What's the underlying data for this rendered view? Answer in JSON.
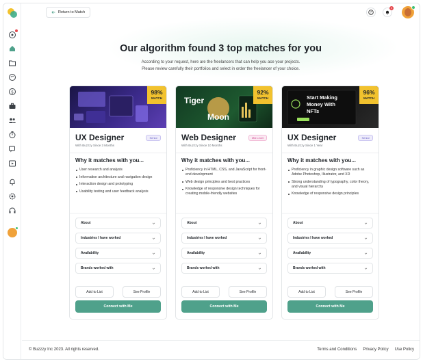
{
  "topbar": {
    "back_label": "Return to Match",
    "notification_count": "3"
  },
  "header": {
    "title": "Our algorithm found 3 top matches for you",
    "subtitle_line1": "According to your request, here are the freelancers that can help you ace your projects.",
    "subtitle_line2": "Please review carefully their portfolios and select in order the freelancer of your choice."
  },
  "cards": [
    {
      "match_pct": "98%",
      "match_label": "MATCH",
      "role": "UX Designer",
      "level": "Senior",
      "since": "With Buzzzy Since 3 Months",
      "why_title": "Why it matches with you...",
      "bullets": [
        "User research and analysis",
        "Information architecture and navigation design",
        "Interaction design and prototyping",
        "Usability testing and user feedback analysis"
      ],
      "accordions": [
        "About",
        "Industries I have worked",
        "Availability",
        "Brands worked with"
      ],
      "add_label": "Add to List",
      "profile_label": "See Profile",
      "connect_label": "Connect with Me",
      "level_color": "#6a63c7",
      "level_bg": "#eeecfb"
    },
    {
      "match_pct": "92%",
      "match_label": "MATCH",
      "role": "Web Designer",
      "level": "Mid Level",
      "since": "With Buzzzy Since 10 Months",
      "why_title": "Why it matches with you...",
      "hero_text_1": "Tiger",
      "hero_text_2": "Moon",
      "bullets": [
        "Proficiency in HTML, CSS, and JavaScript for front-end development",
        "Web design principles and best practices",
        "Knowledge of responsive design techniques for creating mobile-friendly websites"
      ],
      "accordions": [
        "About",
        "Industries I have worked",
        "Availability",
        "Brands worked with"
      ],
      "add_label": "Add to List",
      "profile_label": "See Profile",
      "connect_label": "Connect with Me",
      "level_color": "#d0488f",
      "level_bg": "#fbeaf3"
    },
    {
      "match_pct": "96%",
      "match_label": "MATCH",
      "role": "UX Designer",
      "level": "Senior",
      "since": "With Buzzzy Since 1 Year",
      "why_title": "Why it matches with you...",
      "hero_text_1": "Start Making",
      "hero_text_2": "Money With",
      "hero_text_3": "NFTs",
      "bullets": [
        "Proficiency in graphic design software such as Adobe Photoshop, Illustrator, and XD",
        "Strong understanding of typography, color theory, and visual hierarchy",
        "Knowledge of responsive design principles"
      ],
      "accordions": [
        "About",
        "Industries I have worked",
        "Availability",
        "Brands worked with"
      ],
      "add_label": "Add to List",
      "profile_label": "See Profile",
      "connect_label": "Connect with Me",
      "level_color": "#6a63c7",
      "level_bg": "#eeecfb"
    }
  ],
  "footer": {
    "copyright": "© Buzzzy Inc 2023. All rights reserved.",
    "links": [
      "Terms and Conditions",
      "Privacy Policy",
      "Use Policy"
    ]
  },
  "colors": {
    "accent": "#4fa18b",
    "match_badge": "#f2c22e",
    "notification": "#e5484d",
    "online": "#3fbf73"
  },
  "icons": {
    "sidebar": [
      "target-icon",
      "home-icon",
      "folder-icon",
      "palette-icon",
      "dollar-icon",
      "briefcase-icon",
      "users-icon",
      "timer-icon",
      "chat-icon",
      "video-icon",
      "bell-icon",
      "settings-icon",
      "headset-icon"
    ]
  }
}
